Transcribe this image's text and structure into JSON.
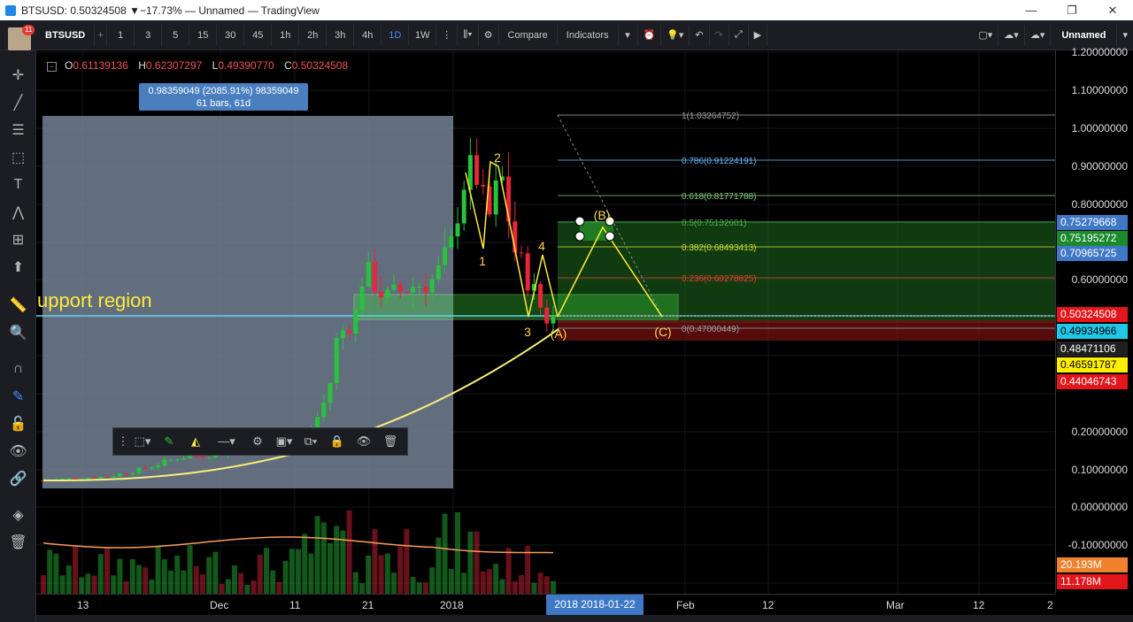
{
  "window": {
    "title": "BTSUSD: 0.50324508 ▼−17.73% — Unnamed — TradingView",
    "minimize": "—",
    "maximize": "❐",
    "close": "✕"
  },
  "toolbar": {
    "badge": "11",
    "symbol": "BTSUSD",
    "intervals": [
      "1",
      "3",
      "5",
      "15",
      "30",
      "45",
      "1h",
      "2h",
      "3h",
      "4h",
      "1D",
      "1W"
    ],
    "active_interval": "1D",
    "compare": "Compare",
    "indicators": "Indicators",
    "layout_name": "Unnamed"
  },
  "legend": {
    "open_label": "O",
    "open": "0.61139136",
    "high_label": "H",
    "high": "0.62307297",
    "low_label": "L",
    "low": "0.49390770",
    "close_label": "C",
    "close": "0.50324508"
  },
  "measure": {
    "line1": "0.98359049 (2085.91%) 98359049",
    "line2": "61 bars, 61d"
  },
  "annotations": {
    "support": "upport region",
    "wave_labels": [
      "1",
      "2",
      "3",
      "4",
      "(A)",
      "(B)",
      "(C)"
    ]
  },
  "fib_levels": [
    {
      "label": "1(1.03264752)",
      "color": "#9e9e9e"
    },
    {
      "label": "0.786(0.91224191)",
      "color": "#64b5f6"
    },
    {
      "label": "0.618(0.81771788)",
      "color": "#81c784"
    },
    {
      "label": "0.5(0.75132601)",
      "color": "#4caf50"
    },
    {
      "label": "0.382(0.68493413)",
      "color": "#cddc39"
    },
    {
      "label": "0.236(0.60278825)",
      "color": "#e53935"
    },
    {
      "label": "0(0.47000449)",
      "color": "#9e9e9e"
    }
  ],
  "price_axis": {
    "ticks": [
      "1.20000000",
      "1.10000000",
      "1.00000000",
      "0.90000000",
      "0.80000000",
      "0.70000000",
      "0.60000000",
      "0.20000000",
      "0.10000000",
      "0.00000000",
      "-0.10000000",
      "-0.2"
    ],
    "labels": [
      {
        "text": "0.75279668",
        "bg": "#3f78c6",
        "fg": "#ffffff"
      },
      {
        "text": "0.75195272",
        "bg": "#1b8a2f",
        "fg": "#ffffff"
      },
      {
        "text": "0.70965725",
        "bg": "#3f78c6",
        "fg": "#ffffff"
      },
      {
        "text": "0.50324508",
        "bg": "#e3161b",
        "fg": "#ffffff"
      },
      {
        "text": "0.49934966",
        "bg": "#1ec8e6",
        "fg": "#000000"
      },
      {
        "text": "0.48471106",
        "bg": "#1f1f1f",
        "fg": "#ffffff"
      },
      {
        "text": "0.46591787",
        "bg": "#ffee00",
        "fg": "#000000"
      },
      {
        "text": "0.44046743",
        "bg": "#e3161b",
        "fg": "#ffffff"
      },
      {
        "text": "20.193M",
        "bg": "#f0822e",
        "fg": "#ffffff"
      },
      {
        "text": "11.178M",
        "bg": "#e3161b",
        "fg": "#ffffff"
      }
    ]
  },
  "time_axis": {
    "ticks": [
      "13",
      "Dec",
      "11",
      "21",
      "2018",
      "Feb",
      "12",
      "Mar",
      "12",
      "2"
    ],
    "crosshair": "2018 2018-01-22"
  },
  "colors": {
    "up": "#26c43a",
    "down": "#e8253a",
    "ma": "#f7ef7c",
    "vol_ma": "#f79c5a"
  }
}
